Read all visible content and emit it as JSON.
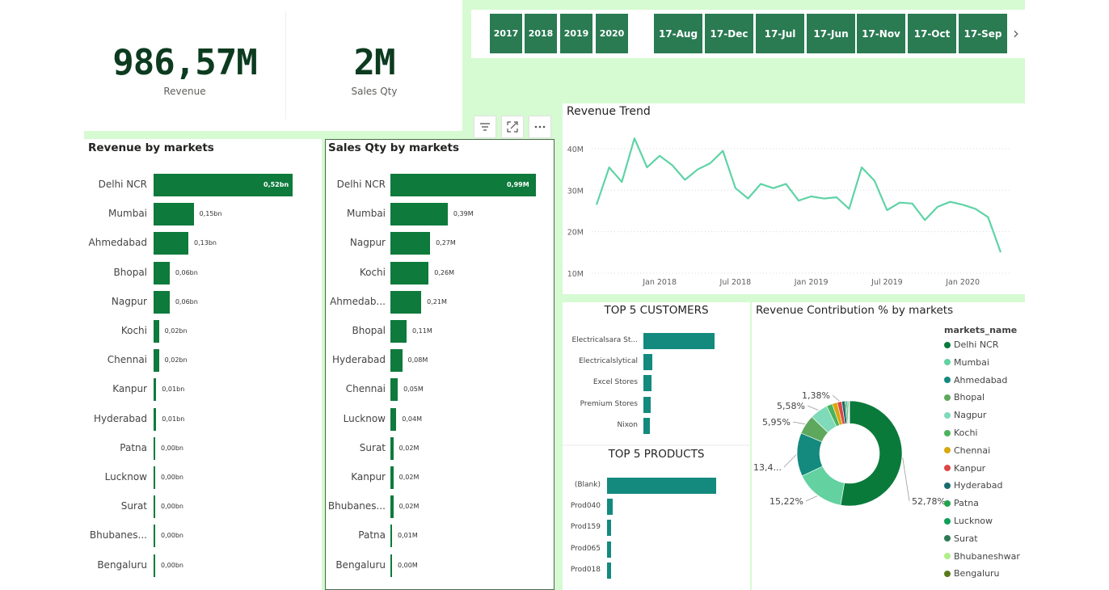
{
  "kpis": [
    {
      "value": "986,57M",
      "label": "Revenue"
    },
    {
      "value": "2M",
      "label": "Sales Qty"
    }
  ],
  "year_slicer": [
    "2017",
    "2018",
    "2019",
    "2020"
  ],
  "month_slicer": [
    "17-Aug",
    "17-Dec",
    "17-Jul",
    "17-Jun",
    "17-Nov",
    "17-Oct",
    "17-Sep"
  ],
  "icons": {
    "scroll_right": "›",
    "filter": "filter-icon",
    "focus": "focus-mode-icon",
    "more": "more-options-icon"
  },
  "revenue_by_markets": {
    "title": "Revenue by markets",
    "color": "#0e7a3c",
    "chart_data": {
      "type": "bar",
      "orientation": "horizontal",
      "categories": [
        "Delhi NCR",
        "Mumbai",
        "Ahmedabad",
        "Bhopal",
        "Nagpur",
        "Kochi",
        "Chennai",
        "Kanpur",
        "Hyderabad",
        "Patna",
        "Lucknow",
        "Surat",
        "Bhubanes...",
        "Bengaluru"
      ],
      "values": [
        0.52,
        0.15,
        0.13,
        0.06,
        0.06,
        0.02,
        0.02,
        0.01,
        0.01,
        0.0,
        0.0,
        0.0,
        0.0,
        0.0
      ],
      "labels": [
        "0,52bn",
        "0,15bn",
        "0,13bn",
        "0,06bn",
        "0,06bn",
        "0,02bn",
        "0,02bn",
        "0,01bn",
        "0,01bn",
        "0,00bn",
        "0,00bn",
        "0,00bn",
        "0,00bn",
        "0,00bn"
      ]
    }
  },
  "sales_qty_by_markets": {
    "title": "Sales Qty by markets",
    "color": "#0e7a3c",
    "chart_data": {
      "type": "bar",
      "orientation": "horizontal",
      "categories": [
        "Delhi NCR",
        "Mumbai",
        "Nagpur",
        "Kochi",
        "Ahmedab...",
        "Bhopal",
        "Hyderabad",
        "Chennai",
        "Lucknow",
        "Surat",
        "Kanpur",
        "Bhubanes...",
        "Patna",
        "Bengaluru"
      ],
      "values": [
        0.99,
        0.39,
        0.27,
        0.26,
        0.21,
        0.11,
        0.08,
        0.05,
        0.04,
        0.02,
        0.02,
        0.02,
        0.01,
        0.0
      ],
      "labels": [
        "0,99M",
        "0,39M",
        "0,27M",
        "0,26M",
        "0,21M",
        "0,11M",
        "0,08M",
        "0,05M",
        "0,04M",
        "0,02M",
        "0,02M",
        "0,02M",
        "0,01M",
        "0,00M"
      ]
    }
  },
  "revenue_trend": {
    "title": "Revenue Trend",
    "color": "#5fd3a6",
    "chart_data": {
      "type": "line",
      "y_ticks": [
        "40M",
        "30M",
        "20M",
        "10M"
      ],
      "y_tick_values": [
        40,
        30,
        20,
        10
      ],
      "ylim": [
        10,
        45
      ],
      "x_ticks": [
        "Jan 2018",
        "Jul 2018",
        "Jan 2019",
        "Jul 2019",
        "Jan 2020"
      ],
      "x_tick_index": [
        5,
        11,
        17,
        23,
        29
      ],
      "values": [
        26.5,
        35.5,
        32,
        42.5,
        35.5,
        38.3,
        36,
        32.5,
        35,
        36.5,
        39.5,
        30.5,
        28,
        31.5,
        30.5,
        31.5,
        27.5,
        28.5,
        28,
        28.3,
        25.5,
        35.5,
        32.3,
        25.2,
        27,
        26.8,
        22.8,
        26,
        27.2,
        26.5,
        25.5,
        23.5,
        15
      ]
    }
  },
  "top5_customers": {
    "title": "TOP 5 CUSTOMERS",
    "color": "#138a7d",
    "chart_data": {
      "type": "bar",
      "categories": [
        "Electricalsara St...",
        "Electricalslytical",
        "Excel Stores",
        "Premium Stores",
        "Nixon"
      ],
      "values": [
        413,
        50,
        49,
        41,
        38
      ]
    }
  },
  "top5_products": {
    "title": "TOP 5 PRODUCTS",
    "color": "#138a7d",
    "chart_data": {
      "type": "bar",
      "categories": [
        "(Blank)",
        "Prod040",
        "Prod159",
        "Prod065",
        "Prod018"
      ],
      "values": [
        620,
        30,
        25,
        24,
        23
      ]
    }
  },
  "revenue_contribution": {
    "title": "Revenue Contribution % by markets",
    "legend_title": "markets_name",
    "chart_data": {
      "type": "pie",
      "donut": true,
      "categories": [
        "Delhi NCR",
        "Mumbai",
        "Ahmedabad",
        "Bhopal",
        "Nagpur",
        "Kochi",
        "Chennai",
        "Kanpur",
        "Hyderabad",
        "Patna",
        "Lucknow",
        "Surat",
        "Bhubaneshwar",
        "Bengaluru"
      ],
      "values": [
        52.78,
        15.22,
        13.4,
        5.95,
        5.58,
        1.8,
        1.6,
        1.38,
        1.0,
        0.4,
        0.4,
        0.3,
        0.2,
        0.1
      ],
      "colors": [
        "#0a7a3a",
        "#63d1a0",
        "#138a7d",
        "#5ea85d",
        "#7fdab9",
        "#4bb35c",
        "#d8a80e",
        "#dd4747",
        "#1a6b6e",
        "#23a24d",
        "#119e57",
        "#2c7a55",
        "#b1ee8a",
        "#5a7a18"
      ],
      "data_labels": {
        "Delhi NCR": "52,78%",
        "Mumbai": "15,22%",
        "Ahmedabad": "13,4...",
        "Bhopal": "5,95%",
        "Nagpur": "5,58%",
        "Kanpur": "1,38%"
      }
    }
  }
}
